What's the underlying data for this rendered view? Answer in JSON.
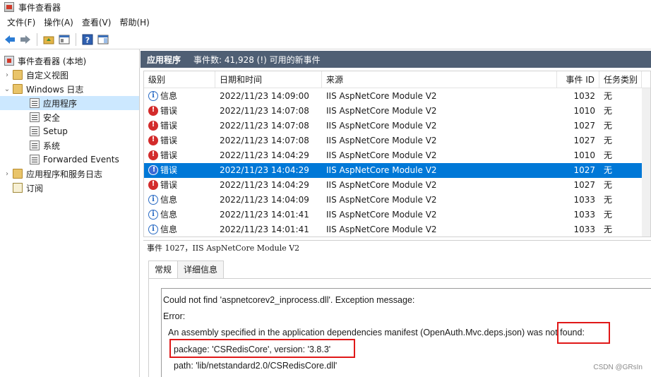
{
  "window": {
    "title": "事件查看器"
  },
  "menu": [
    "文件(F)",
    "操作(A)",
    "查看(V)",
    "帮助(H)"
  ],
  "tree": {
    "root": "事件查看器 (本地)",
    "custom_views": "自定义视图",
    "windows_logs": "Windows 日志",
    "logs": [
      "应用程序",
      "安全",
      "Setup",
      "系统",
      "Forwarded Events"
    ],
    "app_service_logs": "应用程序和服务日志",
    "subscriptions": "订阅"
  },
  "header": {
    "title": "应用程序",
    "info": "事件数: 41,928 (!) 可用的新事件"
  },
  "grid": {
    "columns": [
      "级别",
      "日期和时间",
      "来源",
      "事件 ID",
      "任务类别"
    ],
    "rows": [
      {
        "level": "信息",
        "type": "info",
        "datetime": "2022/11/23 14:09:00",
        "source": "IIS AspNetCore Module V2",
        "id": "1032",
        "category": "无"
      },
      {
        "level": "错误",
        "type": "error",
        "datetime": "2022/11/23 14:07:08",
        "source": "IIS AspNetCore Module V2",
        "id": "1010",
        "category": "无"
      },
      {
        "level": "错误",
        "type": "error",
        "datetime": "2022/11/23 14:07:08",
        "source": "IIS AspNetCore Module V2",
        "id": "1027",
        "category": "无"
      },
      {
        "level": "错误",
        "type": "error",
        "datetime": "2022/11/23 14:07:08",
        "source": "IIS AspNetCore Module V2",
        "id": "1027",
        "category": "无"
      },
      {
        "level": "错误",
        "type": "error",
        "datetime": "2022/11/23 14:04:29",
        "source": "IIS AspNetCore Module V2",
        "id": "1010",
        "category": "无"
      },
      {
        "level": "错误",
        "type": "error",
        "datetime": "2022/11/23 14:04:29",
        "source": "IIS AspNetCore Module V2",
        "id": "1027",
        "category": "无",
        "selected": true
      },
      {
        "level": "错误",
        "type": "error",
        "datetime": "2022/11/23 14:04:29",
        "source": "IIS AspNetCore Module V2",
        "id": "1027",
        "category": "无"
      },
      {
        "level": "信息",
        "type": "info",
        "datetime": "2022/11/23 14:04:09",
        "source": "IIS AspNetCore Module V2",
        "id": "1033",
        "category": "无"
      },
      {
        "level": "信息",
        "type": "info",
        "datetime": "2022/11/23 14:01:41",
        "source": "IIS AspNetCore Module V2",
        "id": "1033",
        "category": "无"
      },
      {
        "level": "信息",
        "type": "info",
        "datetime": "2022/11/23 14:01:41",
        "source": "IIS AspNetCore Module V2",
        "id": "1033",
        "category": "无"
      }
    ]
  },
  "detail": {
    "header": "事件 1027，IIS AspNetCore Module V2",
    "tabs": [
      "常规",
      "详细信息"
    ],
    "message": {
      "line1": "Could not find 'aspnetcorev2_inprocess.dll'. Exception message:",
      "line2": "Error:",
      "line3": "An assembly specified in the application dependencies manifest (OpenAuth.Mvc.deps.json) was not found:",
      "line4": "package: 'CSRedisCore', version: '3.8.3'",
      "line5": "path: 'lib/netstandard2.0/CSRedisCore.dll'"
    }
  },
  "watermark": "CSDN @GRsIn",
  "colors": {
    "selection": "#0078d7",
    "header": "#4f5f74",
    "highlight": "#e01818"
  },
  "icons": [
    "back-icon",
    "forward-icon",
    "folder-up-icon",
    "properties-icon",
    "help-icon",
    "action-pane-icon",
    "error-icon",
    "info-icon"
  ]
}
